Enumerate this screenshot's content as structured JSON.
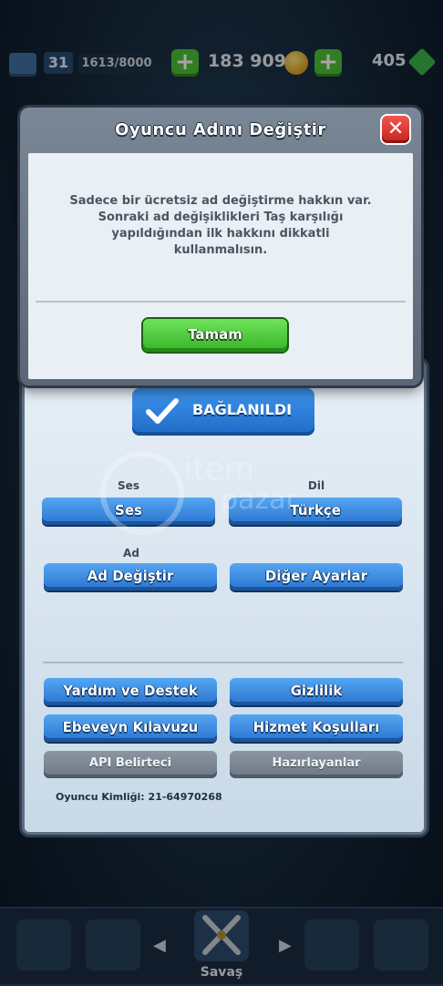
{
  "topbar": {
    "level": "31",
    "xp": "1613/8000",
    "gold": "183 909",
    "gems": "405",
    "plus": "+"
  },
  "modal": {
    "title": "Oyuncu Adını Değiştir",
    "close": "✕",
    "message": "Sadece bir ücretsiz ad değiştirme hakkın var. Sonraki ad değişiklikleri Taş karşılığı yapıldığından ilk hakkını dikkatli kullanmalısın.",
    "ok_label": "Tamam"
  },
  "settings": {
    "connected_label": "BAĞLANILDI",
    "sound_section": "Ses",
    "sound_btn": "Ses",
    "language_section": "Dil",
    "language_btn": "Türkçe",
    "name_section": "Ad",
    "change_name_btn": "Ad Değiştir",
    "other_settings_btn": "Diğer Ayarlar",
    "help_btn": "Yardım ve Destek",
    "privacy_btn": "Gizlilik",
    "parent_guide_btn": "Ebeveyn Kılavuzu",
    "terms_btn": "Hizmet Koşulları",
    "api_btn": "API Belirteci",
    "credits_btn": "Hazırlayanlar",
    "player_id": "Oyuncu Kimliği: 21-64970268"
  },
  "watermark": {
    "line1": "item",
    "line2": "pazar"
  },
  "bottomnav": {
    "battle_label": "Savaş"
  },
  "colors": {
    "accent_blue": "#2a73cf",
    "ok_green": "#36b325",
    "close_red": "#c4241e"
  }
}
